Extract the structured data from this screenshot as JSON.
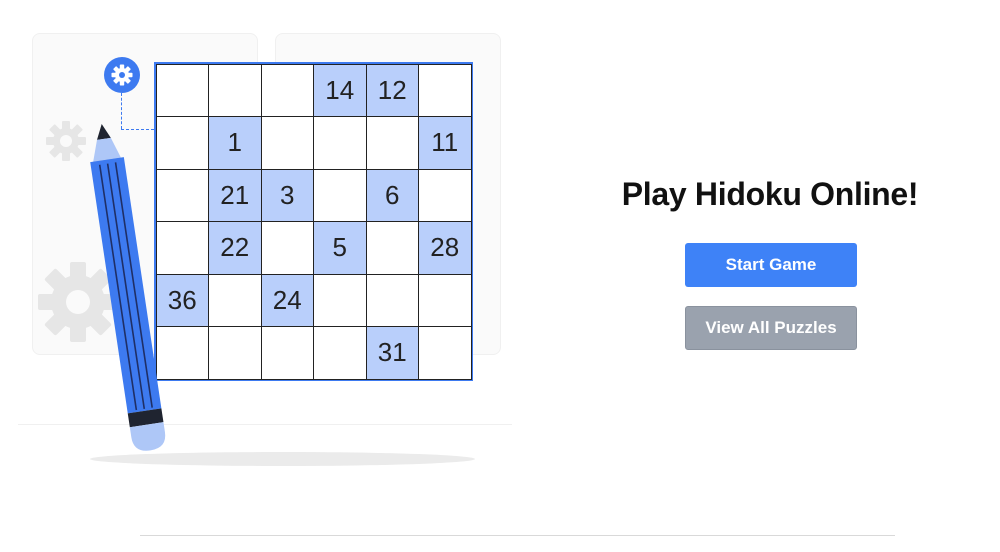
{
  "illustration": {
    "grid": [
      [
        "",
        "",
        "",
        "14",
        "12",
        ""
      ],
      [
        "",
        "1",
        "",
        "",
        "",
        "11"
      ],
      [
        "",
        "21",
        "3",
        "",
        "6",
        ""
      ],
      [
        "",
        "22",
        "",
        "5",
        "",
        "28"
      ],
      [
        "36",
        "",
        "24",
        "",
        "",
        ""
      ],
      [
        "",
        "",
        "",
        "",
        "31",
        ""
      ]
    ],
    "accent_color": "#3d7af0",
    "filled_color": "#b9cffb",
    "icons": [
      "gear-icon",
      "pencil-icon"
    ]
  },
  "hero": {
    "title": "Play Hidoku Online!",
    "start_button": "Start Game",
    "view_button": "View All Puzzles",
    "start_color": "#3e82f7",
    "view_color": "#9aa2ae"
  }
}
